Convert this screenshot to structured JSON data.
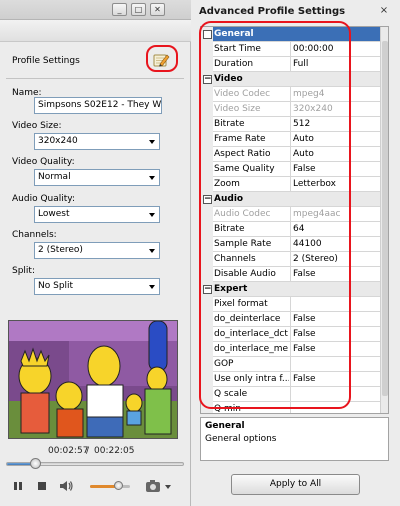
{
  "window_buttons": [
    "_",
    "□",
    "✕"
  ],
  "left": {
    "profile_settings_title": "Profile Settings",
    "name_label": "Name:",
    "name_value": "Simpsons S02E12 - They Way",
    "video_size_label": "Video Size:",
    "video_size_value": "320x240",
    "video_quality_label": "Video Quality:",
    "video_quality_value": "Normal",
    "audio_quality_label": "Audio Quality:",
    "audio_quality_value": "Lowest",
    "channels_label": "Channels:",
    "channels_value": "2 (Stereo)",
    "split_label": "Split:",
    "split_value": "No Split",
    "current_time": "00:02:57",
    "separator": "/",
    "total_time": "00:22:05",
    "seek_fraction": 0.16,
    "volume_fraction": 0.7,
    "icons": [
      "edit-icon",
      "play-pause-icon",
      "stop-icon",
      "volume-icon",
      "snapshot-icon"
    ]
  },
  "right": {
    "title": "Advanced Profile Settings",
    "close": "×",
    "rows": [
      {
        "type": "cat",
        "name": "General"
      },
      {
        "type": "prop",
        "name": "Start Time",
        "value": "00:00:00"
      },
      {
        "type": "prop",
        "name": "Duration",
        "value": "Full"
      },
      {
        "type": "cat",
        "name": "Video"
      },
      {
        "type": "prop",
        "name": "Video Codec",
        "value": "mpeg4",
        "disabled": true
      },
      {
        "type": "prop",
        "name": "Video Size",
        "value": "320x240",
        "disabled": true
      },
      {
        "type": "prop",
        "name": "Bitrate",
        "value": "512"
      },
      {
        "type": "prop",
        "name": "Frame Rate",
        "value": "Auto"
      },
      {
        "type": "prop",
        "name": "Aspect Ratio",
        "value": "Auto"
      },
      {
        "type": "prop",
        "name": "Same Quality",
        "value": "False"
      },
      {
        "type": "prop",
        "name": "Zoom",
        "value": "Letterbox"
      },
      {
        "type": "cat",
        "name": "Audio"
      },
      {
        "type": "prop",
        "name": "Audio Codec",
        "value": "mpeg4aac",
        "disabled": true
      },
      {
        "type": "prop",
        "name": "Bitrate",
        "value": "64"
      },
      {
        "type": "prop",
        "name": "Sample Rate",
        "value": "44100"
      },
      {
        "type": "prop",
        "name": "Channels",
        "value": "2 (Stereo)"
      },
      {
        "type": "prop",
        "name": "Disable Audio",
        "value": "False"
      },
      {
        "type": "cat",
        "name": "Expert"
      },
      {
        "type": "prop",
        "name": "Pixel format",
        "value": ""
      },
      {
        "type": "prop",
        "name": "do_deinterlace",
        "value": "False"
      },
      {
        "type": "prop",
        "name": "do_interlace_dct",
        "value": "False"
      },
      {
        "type": "prop",
        "name": "do_interlace_me",
        "value": "False"
      },
      {
        "type": "prop",
        "name": "GOP",
        "value": ""
      },
      {
        "type": "prop",
        "name": "Use only intra f...",
        "value": "False"
      },
      {
        "type": "prop",
        "name": "Q scale",
        "value": ""
      },
      {
        "type": "prop",
        "name": "Q min",
        "value": ""
      }
    ],
    "description_title": "General",
    "description_body": "General options",
    "apply_all": "Apply to All"
  },
  "colors": {
    "highlight": "#e8141d",
    "selection": "#3b6fb6"
  }
}
